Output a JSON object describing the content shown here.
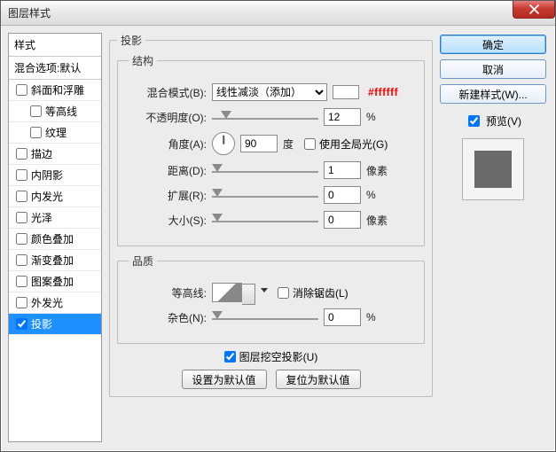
{
  "window": {
    "title": "图层样式"
  },
  "left": {
    "header": "样式",
    "blend_defaults": "混合选项:默认",
    "items": [
      {
        "label": "斜面和浮雕",
        "checked": false
      },
      {
        "label": "等高线",
        "checked": false,
        "indent": true
      },
      {
        "label": "纹理",
        "checked": false,
        "indent": true
      },
      {
        "label": "描边",
        "checked": false
      },
      {
        "label": "内阴影",
        "checked": false
      },
      {
        "label": "内发光",
        "checked": false
      },
      {
        "label": "光泽",
        "checked": false
      },
      {
        "label": "颜色叠加",
        "checked": false
      },
      {
        "label": "渐变叠加",
        "checked": false
      },
      {
        "label": "图案叠加",
        "checked": false
      },
      {
        "label": "外发光",
        "checked": false
      },
      {
        "label": "投影",
        "checked": true,
        "selected": true
      }
    ]
  },
  "center": {
    "main_legend": "投影",
    "structure": {
      "legend": "结构",
      "blend_mode_label": "混合模式(B):",
      "blend_mode_value": "线性减淡（添加）",
      "color_hex": "#ffffff",
      "opacity_label": "不透明度(O):",
      "opacity_value": "12",
      "opacity_unit": "%",
      "angle_label": "角度(A):",
      "angle_value": "90",
      "angle_unit": "度",
      "global_light_label": "使用全局光(G)",
      "global_light_checked": false,
      "distance_label": "距离(D):",
      "distance_value": "1",
      "distance_unit": "像素",
      "spread_label": "扩展(R):",
      "spread_value": "0",
      "spread_unit": "%",
      "size_label": "大小(S):",
      "size_value": "0",
      "size_unit": "像素"
    },
    "quality": {
      "legend": "品质",
      "contour_label": "等高线:",
      "antialias_label": "消除锯齿(L)",
      "antialias_checked": false,
      "noise_label": "杂色(N):",
      "noise_value": "0",
      "noise_unit": "%"
    },
    "knockout_label": "图层挖空投影(U)",
    "knockout_checked": true,
    "btn_set_default": "设置为默认值",
    "btn_reset_default": "复位为默认值"
  },
  "right": {
    "ok": "确定",
    "cancel": "取消",
    "new_style": "新建样式(W)...",
    "preview_label": "预览(V)",
    "preview_checked": true
  }
}
